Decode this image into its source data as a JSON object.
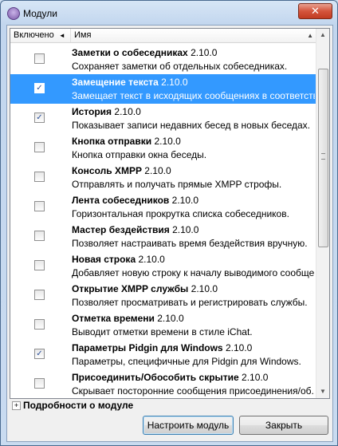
{
  "window": {
    "title": "Модули",
    "close_glyph": "✕"
  },
  "header": {
    "enabled_col": "Включено",
    "enabled_arrow": "◄",
    "name_col": "Имя",
    "sort_arrow": "▲"
  },
  "plugins": [
    {
      "name": "Заметки о собеседниках",
      "version": "2.10.0",
      "desc": "Сохраняет заметки об отдельных собеседниках.",
      "checked": false,
      "selected": false
    },
    {
      "name": "Замещение текста",
      "version": "2.10.0",
      "desc": "Замещает текст в исходящих сообщениях в соответстви...",
      "checked": true,
      "selected": true
    },
    {
      "name": "История",
      "version": "2.10.0",
      "desc": "Показывает записи недавних бесед в новых беседах.",
      "checked": true,
      "selected": false
    },
    {
      "name": "Кнопка отправки",
      "version": "2.10.0",
      "desc": "Кнопка отправки окна беседы.",
      "checked": false,
      "selected": false
    },
    {
      "name": "Консоль XMPP",
      "version": "2.10.0",
      "desc": "Отправлять и получать прямые XMPP строфы.",
      "checked": false,
      "selected": false
    },
    {
      "name": "Лента собеседников",
      "version": "2.10.0",
      "desc": "Горизонтальная прокрутка списка собеседников.",
      "checked": false,
      "selected": false
    },
    {
      "name": "Мастер бездействия",
      "version": "2.10.0",
      "desc": "Позволяет настраивать время бездействия вручную.",
      "checked": false,
      "selected": false
    },
    {
      "name": "Новая строка",
      "version": "2.10.0",
      "desc": "Добавляет новую строку к началу выводимого сообще...",
      "checked": false,
      "selected": false
    },
    {
      "name": "Открытие XMPP службы",
      "version": "2.10.0",
      "desc": "Позволяет просматривать и регистрировать службы.",
      "checked": false,
      "selected": false
    },
    {
      "name": "Отметка времени",
      "version": "2.10.0",
      "desc": "Выводит отметки времени в стиле iChat.",
      "checked": false,
      "selected": false
    },
    {
      "name": "Параметры Pidgin для Windows",
      "version": "2.10.0",
      "desc": "Параметры, специфичные для Pidgin для Windows.",
      "checked": true,
      "selected": false
    },
    {
      "name": "Присоединить/Обособить скрытие",
      "version": "2.10.0",
      "desc": "Скрывает посторонние сообщения присоединения/об...",
      "checked": false,
      "selected": false
    }
  ],
  "details": {
    "expander": "+",
    "label": "Подробности о модуле"
  },
  "buttons": {
    "configure": "Настроить модуль",
    "close": "Закрыть"
  },
  "colors": {
    "selection": "#3399ff",
    "check": "#2a4f9a"
  }
}
